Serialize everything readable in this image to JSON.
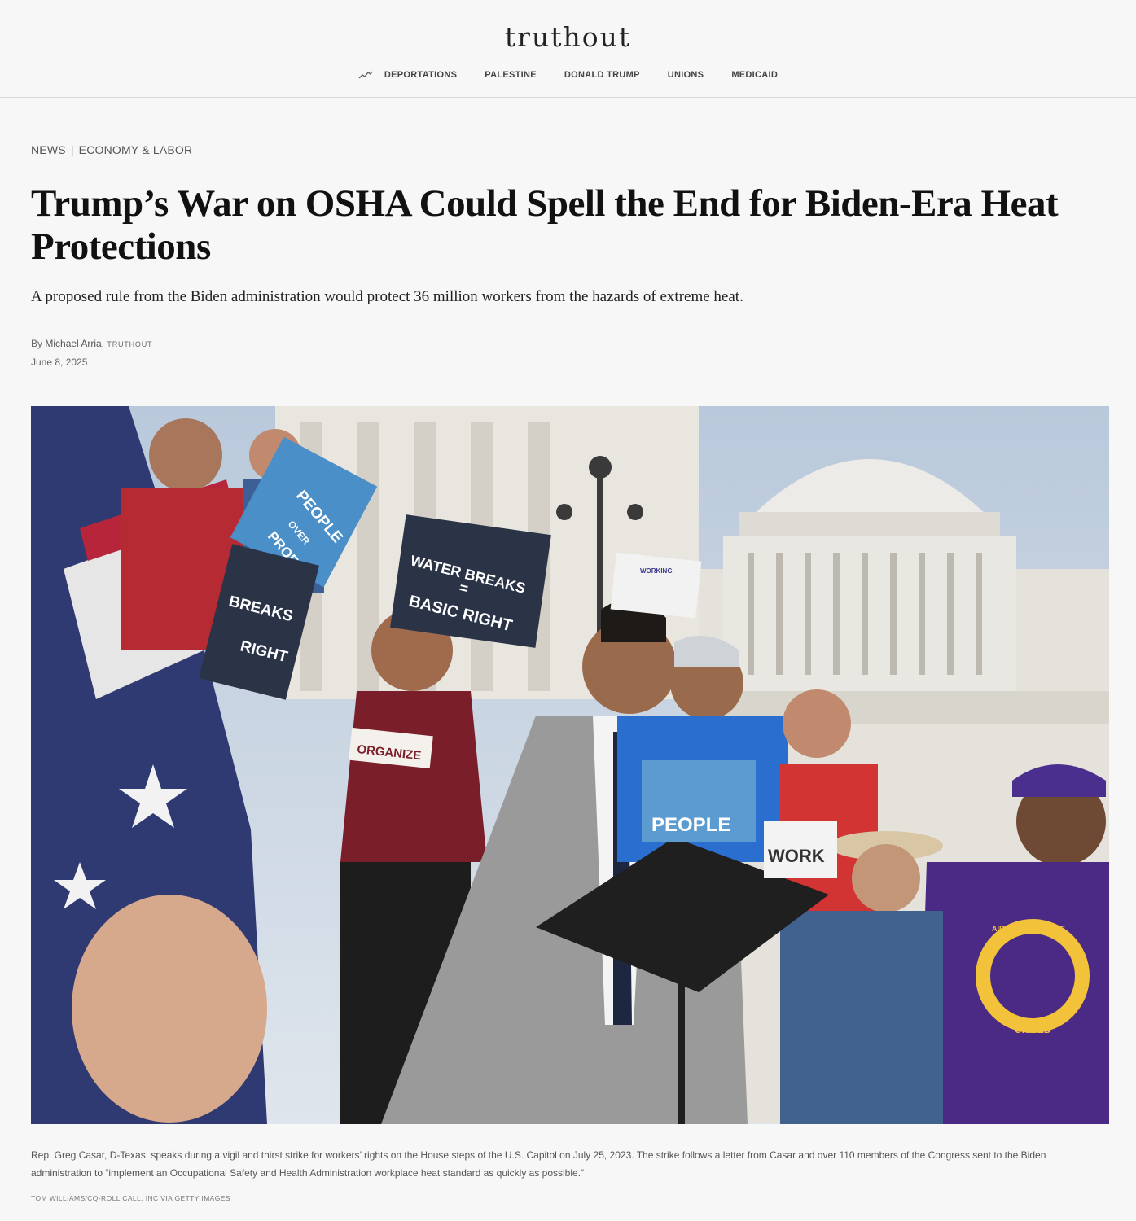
{
  "site": {
    "logo": "truthout"
  },
  "nav": {
    "trending_icon": "trending-icon",
    "items": [
      {
        "label": "DEPORTATIONS"
      },
      {
        "label": "PALESTINE"
      },
      {
        "label": "DONALD TRUMP"
      },
      {
        "label": "UNIONS"
      },
      {
        "label": "MEDICAID"
      }
    ]
  },
  "article": {
    "breadcrumb": {
      "section": "NEWS",
      "separator": "|",
      "category": "ECONOMY & LABOR"
    },
    "headline": "Trump’s War on OSHA Could Spell the End for Biden-Era Heat Protections",
    "dek": "A proposed rule from the Biden administration would protect 36 million workers from the hazards of extreme heat.",
    "byline": {
      "prefix": "By",
      "author": "Michael Arria,",
      "publication": "Truthout"
    },
    "date": "June 8, 2025",
    "photo": {
      "signs": {
        "people_over_profits": [
          "PEOPLE",
          "OVER",
          "PROFITS"
        ],
        "water_breaks": [
          "WATER BREAKS",
          "=",
          "BASIC RIGHT"
        ],
        "breaks_right": [
          "BREAKS",
          "RIGHT"
        ],
        "working": "WORKING",
        "people": "PEOPLE",
        "work": "WORK",
        "organize": "ORGANIZE",
        "airport_workers": [
          "AIRPORT WORKERS",
          "UNITED"
        ]
      },
      "colors": {
        "sky": "#c9d6e4",
        "capitol": "#e8e6e1",
        "sign_blue": "#4a8fc7",
        "sign_navy": "#2b3347",
        "suit_gray": "#9a9a9a",
        "shirt_purple": "#4a2a84",
        "shirt_maroon": "#7a1e2a"
      }
    },
    "caption": "Rep. Greg Casar, D-Texas, speaks during a vigil and thirst strike for workers’ rights on the House steps of the U.S. Capitol on July 25, 2023. The strike follows a letter from Casar and over 110 members of the Congress sent to the Biden administration to “implement an Occupational Safety and Health Administration workplace heat standard as quickly as possible.”",
    "credit": "Tom Williams/CQ-Roll Call, Inc via Getty Images"
  }
}
